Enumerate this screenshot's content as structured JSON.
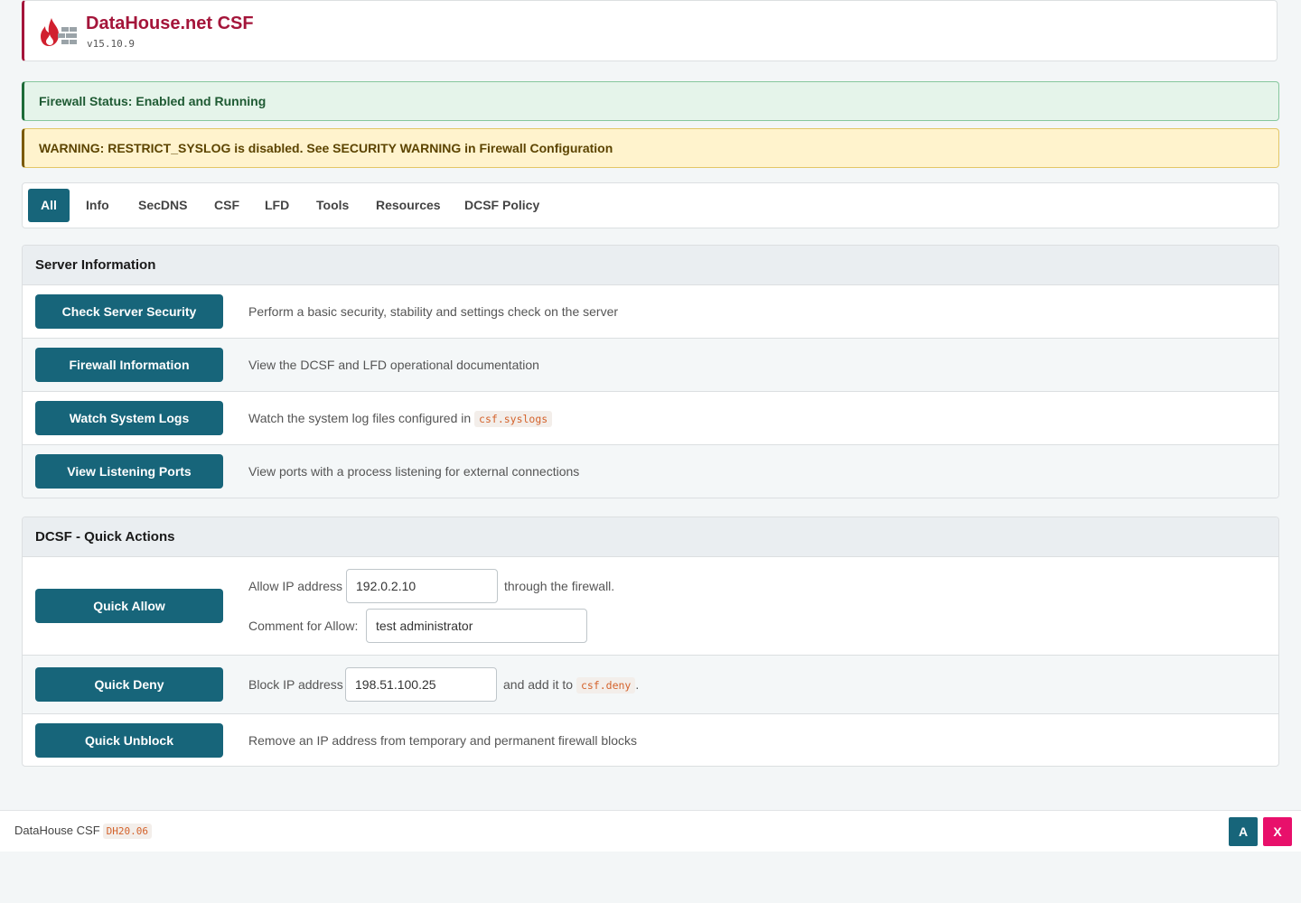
{
  "header": {
    "title": "DataHouse.net CSF",
    "version": "v15.10.9",
    "logo_icon": "firewall-flame-icon"
  },
  "alerts": {
    "status": "Firewall Status: Enabled and Running",
    "warning": "WARNING: RESTRICT_SYSLOG is disabled. See SECURITY WARNING in Firewall Configuration"
  },
  "tabs": [
    "All",
    "Info",
    "SecDNS",
    "CSF",
    "LFD",
    "Tools",
    "Resources",
    "DCSF Policy"
  ],
  "server_info": {
    "title": "Server Information",
    "rows": [
      {
        "button": "Check Server Security",
        "desc": "Perform a basic security, stability and settings check on the server"
      },
      {
        "button": "Firewall Information",
        "desc": "View the DCSF and LFD operational documentation"
      },
      {
        "button": "Watch System Logs",
        "desc": "Watch the system log files configured in",
        "code": "csf.syslogs"
      },
      {
        "button": "View Listening Ports",
        "desc": "View ports with a process listening for external connections"
      }
    ]
  },
  "quick_actions": {
    "title": "DCSF - Quick Actions",
    "allow": {
      "button": "Quick Allow",
      "ip_label": "Allow IP address",
      "ip_value": "192.0.2.10",
      "after": "through the firewall.",
      "comment_label": "Comment for Allow:",
      "comment_value": "test administrator"
    },
    "deny": {
      "button": "Quick Deny",
      "ip_label": "Block IP address",
      "ip_value": "198.51.100.25",
      "after": "and add it to",
      "code": "csf.deny",
      "period": "."
    },
    "unblock": {
      "button": "Quick Unblock",
      "desc": "Remove an IP address from temporary and permanent firewall blocks"
    }
  },
  "footer": {
    "text": "DataHouse CSF",
    "code": "DH20.06",
    "btn_a": "A",
    "btn_x": "X"
  },
  "colors": {
    "primary": "#17657a",
    "brand": "#a4153a",
    "accent_pink": "#e8106b",
    "code": "#d4622b"
  }
}
